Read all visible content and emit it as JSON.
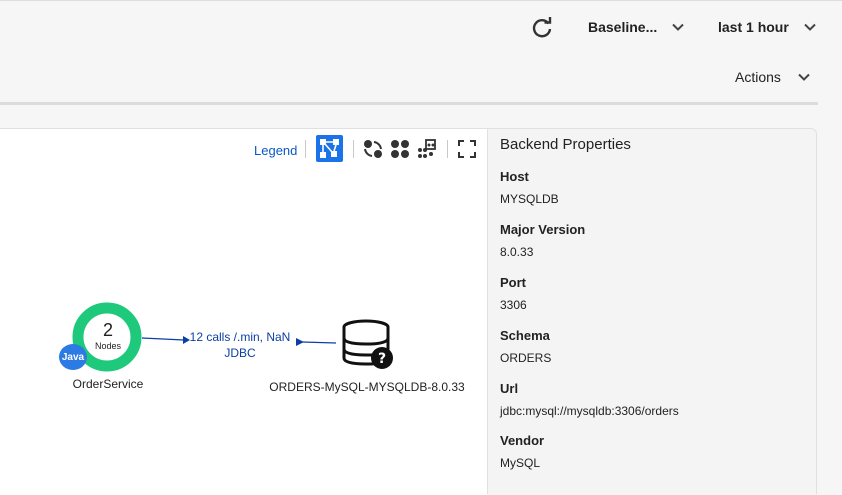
{
  "header": {
    "baseline_label": "Baseline...",
    "time_range_label": "last 1 hour",
    "actions_label": "Actions"
  },
  "toolbar": {
    "legend_label": "Legend",
    "icons": [
      "topology-icon",
      "refresh-layout-icon",
      "group-nodes-icon",
      "cluster-icon",
      "fullscreen-icon"
    ]
  },
  "graph": {
    "service_node": {
      "count": "2",
      "count_label": "Nodes",
      "badge": "Java",
      "label": "OrderService"
    },
    "edge": {
      "line1": "12 calls /.min, NaN",
      "line2": "JDBC"
    },
    "backend_node": {
      "label": "ORDERS-MySQL-MYSQLDB-8.0.33"
    }
  },
  "properties": {
    "title": "Backend Properties",
    "items": [
      {
        "key": "Host",
        "value": "MYSQLDB"
      },
      {
        "key": "Major Version",
        "value": "8.0.33"
      },
      {
        "key": "Port",
        "value": "3306"
      },
      {
        "key": "Schema",
        "value": "ORDERS"
      },
      {
        "key": "Url",
        "value": "jdbc:mysql://mysqldb:3306/orders"
      },
      {
        "key": "Vendor",
        "value": "MySQL"
      }
    ]
  },
  "colors": {
    "accent": "#1a73e8",
    "link": "#0b58c5",
    "node_ring": "#1ec97b",
    "edge": "#0b3fa6",
    "java_badge": "#2c7be5"
  }
}
